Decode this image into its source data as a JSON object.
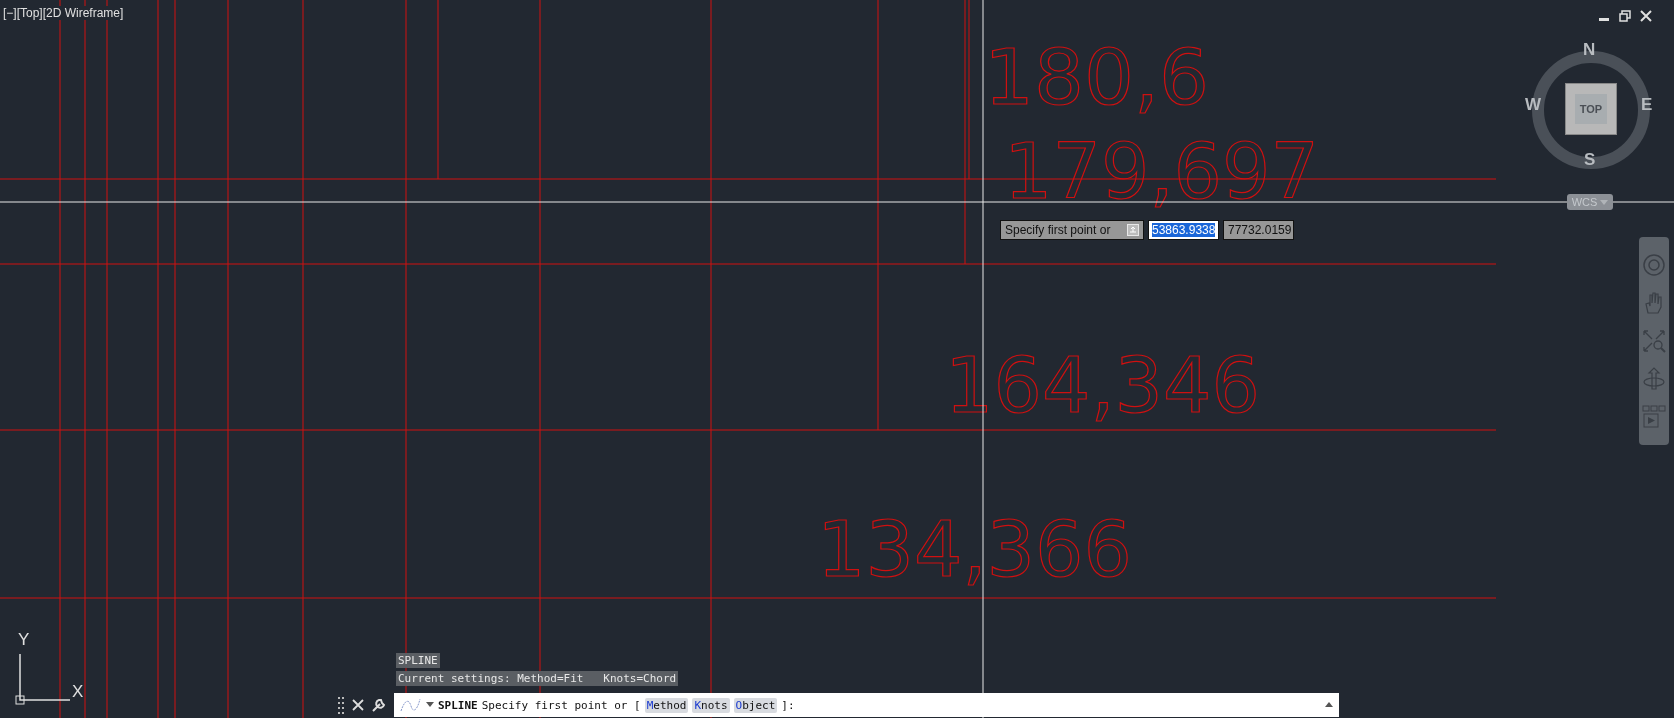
{
  "viewport_label": "[−][Top][2D Wireframe]",
  "drawing": {
    "dimension_texts": [
      "180,6",
      "179,697",
      "164,346",
      "134,366"
    ]
  },
  "viewcube": {
    "face": "TOP",
    "north": "N",
    "east": "E",
    "south": "S",
    "west": "W",
    "ucs": "WCS"
  },
  "dynamic_input": {
    "prompt": "Specify first point or",
    "x_value": "53863.9338",
    "y_value": "77732.0159"
  },
  "command_history": [
    "SPLINE",
    "Current settings: Method=Fit   Knots=Chord"
  ],
  "command_line": {
    "command": "SPLINE",
    "prompt": "Specify first point or [",
    "options": [
      "Method",
      "Knots",
      "Object"
    ],
    "suffix": "]:"
  },
  "ucs_icon": {
    "x_label": "X",
    "y_label": "Y"
  }
}
